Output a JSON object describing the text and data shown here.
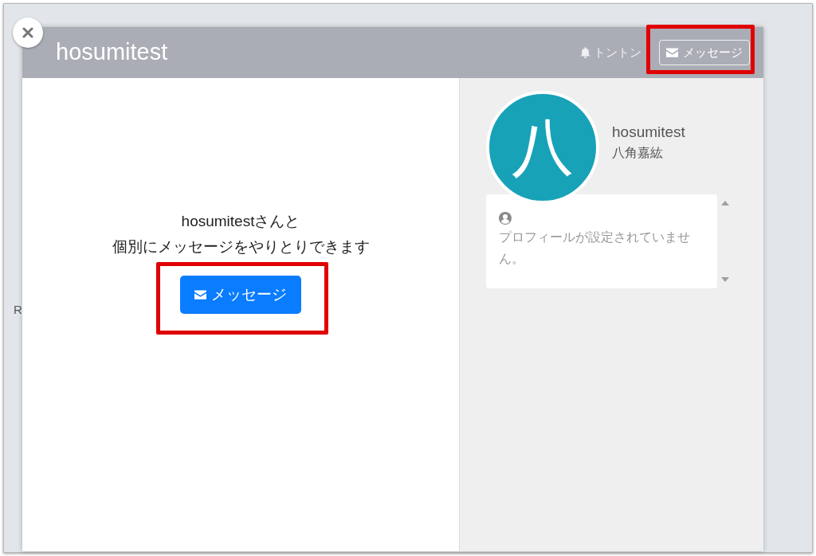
{
  "background": {
    "label": "R"
  },
  "modal": {
    "title": "hosumitest",
    "header_actions": [
      {
        "kind": "link",
        "label": "トントン"
      },
      {
        "kind": "outline_button",
        "label": "メッセージ",
        "highlighted": true
      }
    ],
    "intro": {
      "lines": [
        "hosumitestさんと",
        "個別にメッセージをやりとりできます"
      ]
    },
    "message_button": {
      "label": "メッセージ",
      "highlighted": true
    },
    "profile": {
      "avatar_initial": "八",
      "username": "hosumitest",
      "full_name": "八角嘉紘",
      "bio": "プロフィールが設定されていません。"
    }
  }
}
